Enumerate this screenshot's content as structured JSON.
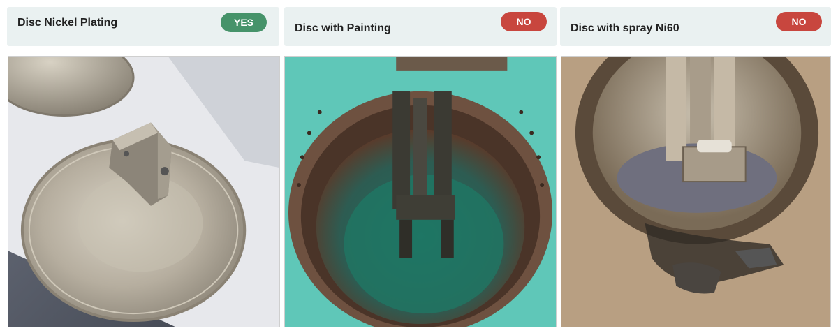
{
  "cards": [
    {
      "title": "Disc Nickel Plating",
      "badge": "YES",
      "badge_color": "#46936a",
      "photo_icon": "nickel-plated-disc-photo"
    },
    {
      "title": "Disc with Painting",
      "badge": "NO",
      "badge_color": "#c8463e",
      "photo_icon": "painted-disc-photo"
    },
    {
      "title": "Disc with spray Ni60",
      "badge": "NO",
      "badge_color": "#c8463e",
      "photo_icon": "ni60-sprayed-disc-photo"
    }
  ]
}
